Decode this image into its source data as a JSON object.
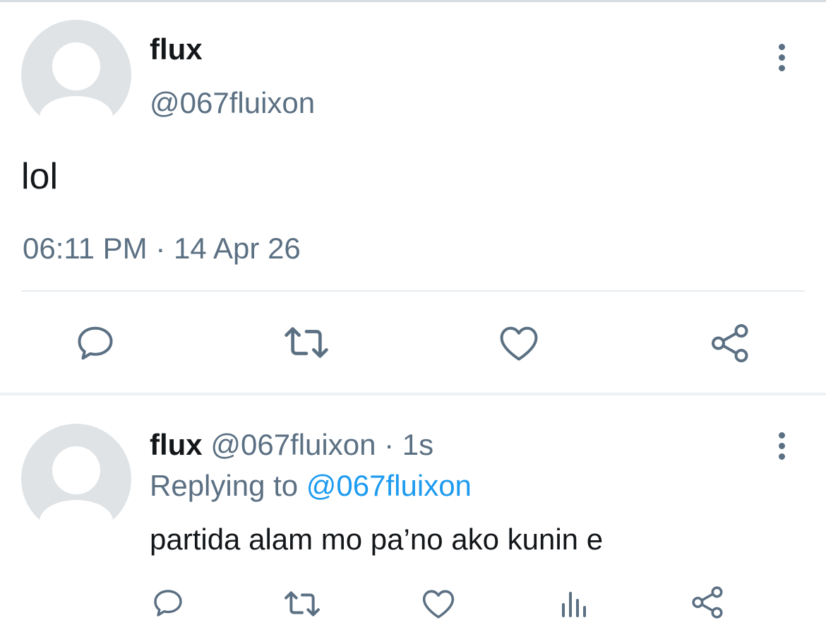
{
  "main_tweet": {
    "author_name": "flux",
    "author_handle": "@067fluixon",
    "text": "lol",
    "timestamp": "06:11 PM · 14 Apr 26",
    "icons": {
      "more": "more-vertical-icon",
      "reply": "reply-icon",
      "retweet": "retweet-icon",
      "like": "heart-icon",
      "share": "share-icon"
    }
  },
  "reply_tweet": {
    "author_name": "flux",
    "author_handle": "@067fluixon",
    "time": "· 1s",
    "replying_label": "Replying to",
    "replying_handle": "@067fluixon",
    "text": "partida alam mo pa’no ako kunin e",
    "icons": {
      "more": "more-vertical-icon",
      "reply": "reply-icon",
      "retweet": "retweet-icon",
      "like": "heart-icon",
      "analytics": "analytics-icon",
      "share": "share-icon"
    }
  },
  "colors": {
    "text_primary": "#14171a",
    "text_secondary": "#5b7083",
    "link": "#1d9bf0",
    "divider": "#e6ecf0",
    "avatar_bg": "#dfe3e6"
  }
}
